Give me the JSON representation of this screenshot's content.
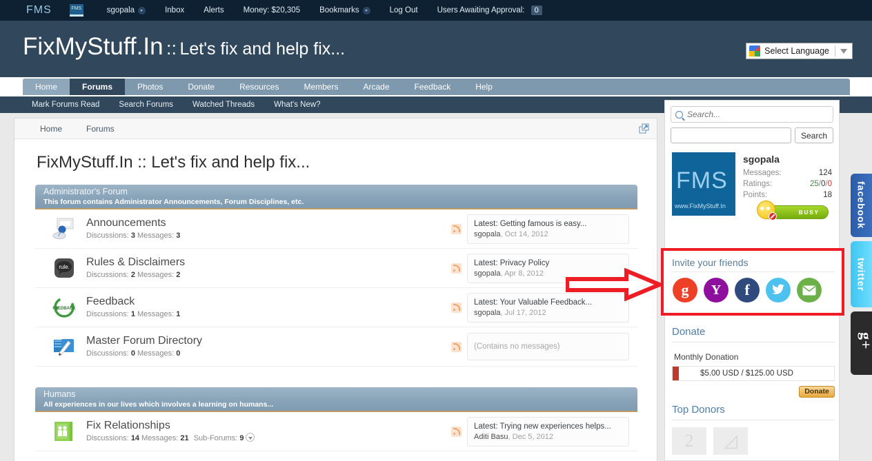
{
  "topbar": {
    "brand": "FMS",
    "logo_text": "FMS",
    "username": "sgopala",
    "items": [
      {
        "label": "Inbox"
      },
      {
        "label": "Alerts"
      },
      {
        "label": "Money: $20,305"
      },
      {
        "label": "Bookmarks"
      },
      {
        "label": "Log Out"
      }
    ],
    "approval_label": "Users Awaiting Approval:",
    "approval_count": "0"
  },
  "header": {
    "title_main": "FixMyStuff.In",
    "title_sep": "::",
    "title_sub": "Let's fix and help fix...",
    "language_selector": "Select Language"
  },
  "nav": {
    "tabs": [
      {
        "label": "Home",
        "active": false
      },
      {
        "label": "Forums",
        "active": true
      },
      {
        "label": "Photos",
        "active": false
      },
      {
        "label": "Donate",
        "active": false
      },
      {
        "label": "Resources",
        "active": false
      },
      {
        "label": "Members",
        "active": false
      },
      {
        "label": "Arcade",
        "active": false
      },
      {
        "label": "Feedback",
        "active": false
      },
      {
        "label": "Help",
        "active": false
      }
    ],
    "subnav": [
      {
        "label": "Mark Forums Read"
      },
      {
        "label": "Search Forums"
      },
      {
        "label": "Watched Threads"
      },
      {
        "label": "What's New?"
      }
    ]
  },
  "breadcrumb": {
    "items": [
      {
        "label": "Home"
      },
      {
        "label": "Forums"
      }
    ]
  },
  "page": {
    "title": "FixMyStuff.In :: Let's fix and help fix..."
  },
  "categories": [
    {
      "title": "Administrator's Forum",
      "description": "This forum contains Administrator Announcements, Forum Disciplines, etc.",
      "nodes": [
        {
          "title": "Announcements",
          "stats_discussions_label": "Discussions:",
          "discussions": "3",
          "stats_messages_label": "Messages:",
          "messages": "3",
          "icon": "announcement-icon",
          "last_post_title": "Latest: Getting famous is easy...",
          "last_post_user": "sgopala",
          "last_post_date": "Oct 14, 2012",
          "empty": false
        },
        {
          "title": "Rules & Disclaimers",
          "stats_discussions_label": "Discussions:",
          "discussions": "2",
          "stats_messages_label": "Messages:",
          "messages": "2",
          "icon": "rules-icon",
          "last_post_title": "Latest: Privacy Policy",
          "last_post_user": "sgopala",
          "last_post_date": "Apr 8, 2012",
          "empty": false
        },
        {
          "title": "Feedback",
          "stats_discussions_label": "Discussions:",
          "discussions": "1",
          "stats_messages_label": "Messages:",
          "messages": "1",
          "icon": "feedback-icon",
          "last_post_title": "Latest: Your Valuable Feedback...",
          "last_post_user": "sgopala",
          "last_post_date": "Jul 17, 2012",
          "empty": false
        },
        {
          "title": "Master Forum Directory",
          "stats_discussions_label": "Discussions:",
          "discussions": "0",
          "stats_messages_label": "Messages:",
          "messages": "0",
          "icon": "folder-icon",
          "empty_text": "(Contains no messages)",
          "empty": true
        }
      ]
    },
    {
      "title": "Humans",
      "description": "All experiences in our lives which involves a learning on humans...",
      "nodes": [
        {
          "title": "Fix Relationships",
          "stats_discussions_label": "Discussions:",
          "discussions": "14",
          "stats_messages_label": "Messages:",
          "messages": "21",
          "stats_subforums_label": "Sub-Forums:",
          "subforums": "9",
          "icon": "people-icon",
          "last_post_title": "Latest: Trying new experiences helps...",
          "last_post_user": "Aditi Basu",
          "last_post_date": "Dec 5, 2012",
          "empty": false
        }
      ]
    }
  ],
  "sidebar": {
    "search_placeholder": "Search...",
    "search_value": "",
    "search2_value": "",
    "search2_button": "Search",
    "profile": {
      "avatar_text": "FMS",
      "avatar_url": "www.FixMyStuff.In",
      "name": "sgopala",
      "messages_label": "Messages:",
      "messages_value": "124",
      "ratings_label": "Ratings:",
      "ratings_good": "25",
      "ratings_neutral": "0",
      "ratings_bad": "0",
      "points_label": "Points:",
      "points_value": "18",
      "status_text": "BUSY"
    },
    "invite": {
      "title": "Invite your friends",
      "icons": [
        {
          "name": "google-icon",
          "glyph": "g"
        },
        {
          "name": "yahoo-icon",
          "glyph": "Y"
        },
        {
          "name": "facebook-icon",
          "glyph": "f"
        },
        {
          "name": "twitter-icon",
          "glyph": "ᴠ"
        },
        {
          "name": "email-icon",
          "glyph": "✉"
        }
      ]
    },
    "donate": {
      "heading": "Donate",
      "label": "Monthly Donation",
      "progress_text": "$5.00 USD / $125.00 USD",
      "current": 5,
      "goal": 125,
      "button": "Donate"
    },
    "top_donors": {
      "heading": "Top Donors"
    }
  },
  "edge_tabs": [
    {
      "label": "facebook",
      "name": "facebook-edge-tab"
    },
    {
      "label": "twitter",
      "name": "twitter-edge-tab"
    },
    {
      "label": "g+",
      "name": "googleplus-edge-tab"
    }
  ],
  "colors": {
    "header_bg": "#30475c",
    "topbar_bg": "#0d2133",
    "accent": "#4a7fae",
    "highlight_red": "#ee1c24",
    "category_bar": "#8aa5ba"
  }
}
